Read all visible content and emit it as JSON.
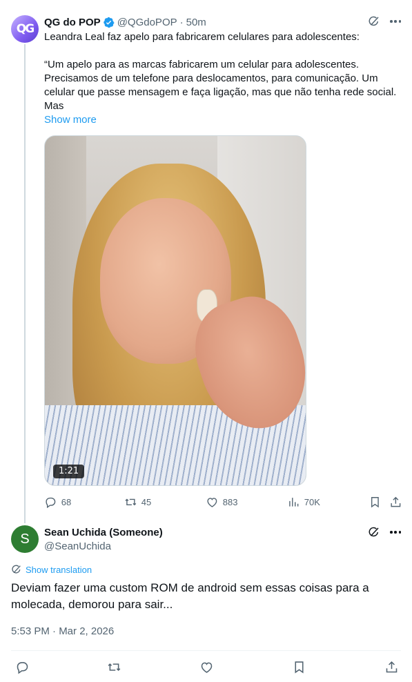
{
  "post": {
    "author_name": "QG do POP",
    "handle": "@QGdoPOP",
    "separator": "·",
    "time": "50m",
    "avatar_text": "QG",
    "text_line1": "Leandra Leal faz apelo para fabricarem celulares para adolescentes:",
    "text_quote": "“Um apelo para as marcas fabricarem um celular para adolescentes. Precisamos de um telefone para deslocamentos, para comunicação. Um celular que passe mensagem e faça ligação, mas que não tenha rede social. Mas",
    "show_more": "Show more",
    "video_duration": "1:21",
    "stats": {
      "replies": "68",
      "reposts": "45",
      "likes": "883",
      "views": "70K"
    }
  },
  "reply": {
    "author_name": "Sean Uchida (Someone)",
    "handle": "@SeanUchida",
    "avatar_letter": "S",
    "show_translation": "Show translation",
    "text": "Deviam fazer uma custom ROM de android sem essas coisas para a molecada, demorou para sair...",
    "timestamp": "5:53 PM · Mar 2, 2026"
  },
  "colors": {
    "accent": "#1d9bf0",
    "secondary_text": "#536471",
    "primary_text": "#0f1419",
    "verified": "#1d9bf0",
    "reply_avatar": "#2e7d32"
  },
  "icons": [
    "verified-badge-icon",
    "grok-icon",
    "more-icon",
    "reply-icon",
    "repost-icon",
    "like-icon",
    "views-icon",
    "bookmark-icon",
    "share-icon",
    "translate-icon"
  ]
}
